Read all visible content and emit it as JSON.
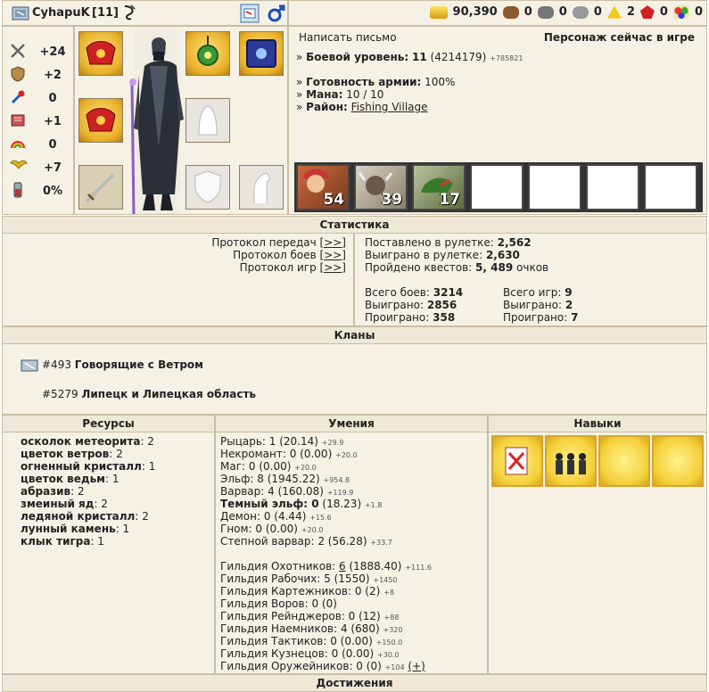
{
  "header": {
    "player_name": "CyhapuK",
    "level_badge": "[11]",
    "resources": [
      {
        "icon": "gold-icon",
        "value": "90,390"
      },
      {
        "icon": "wood-icon",
        "value": "0"
      },
      {
        "icon": "ore-icon",
        "value": "0"
      },
      {
        "icon": "mercury-icon",
        "value": "0"
      },
      {
        "icon": "sulfur-icon",
        "value": "2"
      },
      {
        "icon": "crystal-icon",
        "value": "0"
      },
      {
        "icon": "gems-icon",
        "value": "0"
      }
    ]
  },
  "stats": [
    {
      "icon": "attack-icon",
      "value": "+24"
    },
    {
      "icon": "defense-icon",
      "value": "+2"
    },
    {
      "icon": "spellpower-icon",
      "value": "0"
    },
    {
      "icon": "knowledge-icon",
      "value": "+1"
    },
    {
      "icon": "luck-icon",
      "value": "0"
    },
    {
      "icon": "morale-icon",
      "value": "+7"
    },
    {
      "icon": "initiative-icon",
      "value": "0%"
    }
  ],
  "info": {
    "write_letter": "Написать письмо",
    "online_status": "Персонаж сейчас в игре",
    "combat_level_label": "Боевой уровень:",
    "combat_level_value": "11",
    "combat_exp": "(4214179)",
    "combat_exp_bonus": "+785821",
    "army_label": "Готовность армии:",
    "army_value": "100%",
    "mana_label": "Мана:",
    "mana_value": "10 / 10",
    "district_label": "Район:",
    "district_value": "Fishing Village"
  },
  "army": [
    "54",
    "39",
    "17"
  ],
  "statistics": {
    "title": "Статистика",
    "protocols": [
      {
        "label": "Протокол передач",
        "link": "[>>]"
      },
      {
        "label": "Протокол боев",
        "link": "[>>]"
      },
      {
        "label": "Протокол игр",
        "link": "[>>]"
      }
    ],
    "roulette_placed_label": "Поставлено в рулетке:",
    "roulette_placed_value": "2,562",
    "roulette_won_label": "Выиграно в рулетке:",
    "roulette_won_value": "2,630",
    "quests_label": "Пройдено квестов:",
    "quests_value": "5",
    "quests_points": ", 489",
    "quests_points_suffix": "очков",
    "battles_total_label": "Всего боев:",
    "battles_total_value": "3214",
    "battles_won_label": "Выиграно:",
    "battles_won_value": "2856",
    "battles_lost_label": "Проиграно:",
    "battles_lost_value": "358",
    "games_total_label": "Всего игр:",
    "games_total_value": "9",
    "games_won_label": "Выиграно:",
    "games_won_value": "2",
    "games_lost_label": "Проиграно:",
    "games_lost_value": "7"
  },
  "clans": {
    "title": "Кланы",
    "list": [
      {
        "id": "#493",
        "name": "Говорящие с Ветром"
      },
      {
        "id": "#5279",
        "name": "Липецк и Липецкая область"
      }
    ]
  },
  "resources_section": {
    "title": "Ресурсы",
    "items": [
      {
        "name": "осколок метеорита",
        "count": ": 2"
      },
      {
        "name": "цветок ветров",
        "count": ": 2"
      },
      {
        "name": "огненный кристалл",
        "count": ": 1"
      },
      {
        "name": "цветок ведьм",
        "count": ": 1"
      },
      {
        "name": "абразив",
        "count": ": 2"
      },
      {
        "name": "змеиный яд",
        "count": ": 2"
      },
      {
        "name": "ледяной кристалл",
        "count": ": 2"
      },
      {
        "name": "лунный камень",
        "count": ": 1"
      },
      {
        "name": "клык тигра",
        "count": ": 1"
      }
    ]
  },
  "skills_section": {
    "title": "Умения",
    "factions": [
      {
        "text": "Рыцарь: 1 (20.14)",
        "bonus": "+29.9",
        "bold": false
      },
      {
        "text": "Некромант: 0 (0.00)",
        "bonus": "+20.0",
        "bold": false
      },
      {
        "text": "Маг: 0 (0.00)",
        "bonus": "+20.0",
        "bold": false
      },
      {
        "text": "Эльф: 8 (1945.22)",
        "bonus": "+954.8",
        "bold": false
      },
      {
        "text": "Варвар: 4 (160.08)",
        "bonus": "+119.9",
        "bold": false
      },
      {
        "text_bold": "Темный эльф: 0",
        "text": " (18.23)",
        "bonus": "+1.8",
        "bold": true
      },
      {
        "text": "Демон: 0 (4.44)",
        "bonus": "+15.6",
        "bold": false
      },
      {
        "text": "Гном: 0 (0.00)",
        "bonus": "+20.0",
        "bold": false
      },
      {
        "text": "Степной варвар: 2 (56.28)",
        "bonus": "+33.7",
        "bold": false
      }
    ],
    "guilds": [
      {
        "pre": "Гильдия Охотников: ",
        "link": "6",
        "post": " (1888.40)",
        "bonus": "+111.6"
      },
      {
        "pre": "Гильдия Рабочих: 5 (1550)",
        "link": "",
        "post": "",
        "bonus": "+1450"
      },
      {
        "pre": "Гильдия Картежников: 0 (2)",
        "link": "",
        "post": "",
        "bonus": "+8"
      },
      {
        "pre": "Гильдия Воров: 0 (0)",
        "link": "",
        "post": "",
        "bonus": ""
      },
      {
        "pre": "Гильдия Рейнджеров: 0 (12)",
        "link": "",
        "post": "",
        "bonus": "+88"
      },
      {
        "pre": "Гильдия Наемников: 4 (680)",
        "link": "",
        "post": "",
        "bonus": "+320"
      },
      {
        "pre": "Гильдия Тактиков: 0 (0.00)",
        "link": "",
        "post": "",
        "bonus": "+150.0"
      },
      {
        "pre": "Гильдия Кузнецов: 0 (0.00)",
        "link": "",
        "post": "",
        "bonus": "+30.0"
      },
      {
        "pre": "Гильдия Оружейников: 0 (0)",
        "link": "",
        "post": "",
        "bonus": "+104",
        "extra": "(+)"
      }
    ]
  },
  "talents_section": {
    "title": "Навыки"
  },
  "achievements": {
    "title": "Достижения"
  }
}
